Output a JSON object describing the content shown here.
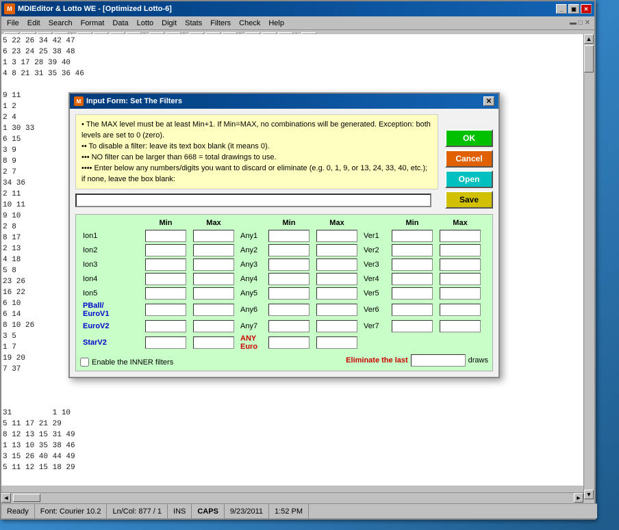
{
  "app": {
    "title": "MDIEditor & Lotto WE - [Optimized Lotto-6]",
    "icon_char": "M"
  },
  "title_buttons": {
    "minimize": "_",
    "restore": "▣",
    "close": "✕"
  },
  "menu": {
    "items": [
      "File",
      "Edit",
      "Search",
      "Format",
      "Data",
      "Lotto",
      "Digit",
      "Stats",
      "Filters",
      "Check",
      "Help"
    ]
  },
  "toolbar": {
    "buttons": [
      "📄",
      "📂",
      "💾",
      "🖨",
      "✂",
      "📋",
      "📋",
      "✕",
      "🔍",
      "A",
      "B",
      "I",
      "U",
      "≡",
      "≡",
      "≡",
      "❓"
    ]
  },
  "dialog": {
    "title": "Input Form: Set The Filters",
    "icon_char": "M",
    "close_btn": "✕",
    "info_lines": [
      "• The MAX level must be at least Min+1. If Min=MAX, no combinations will be generated.  Exception: both levels are set to 0 (zero).",
      "•• To disable a filter: leave its text box blank (it means 0).",
      "••• NO filter can be larger than 668 = total drawings to use.",
      "•••• Enter below any numbers/digits you want to discard or eliminate  (e.g.  0, 1, 9, or 13, 24, 33, 40, etc.);  if none, leave the box blank:"
    ],
    "buttons": {
      "ok": "OK",
      "cancel": "Cancel",
      "open": "Open",
      "save": "Save"
    }
  },
  "grid": {
    "col_headers": [
      "",
      "Min",
      "Max",
      "",
      "Min",
      "Max",
      "",
      "Min",
      "Max"
    ],
    "rows": [
      {
        "label": "Ion1",
        "label_style": "normal",
        "col": "ion"
      },
      {
        "label": "Ion2",
        "label_style": "normal",
        "col": "ion"
      },
      {
        "label": "Ion3",
        "label_style": "normal",
        "col": "ion"
      },
      {
        "label": "Ion4",
        "label_style": "normal",
        "col": "ion"
      },
      {
        "label": "Ion5",
        "label_style": "normal",
        "col": "ion"
      },
      {
        "label": "PBall/\nEuroV1",
        "label_style": "blue",
        "col": "pball"
      },
      {
        "label": "EuroV2",
        "label_style": "blue",
        "col": "euro"
      },
      {
        "label": "StarV2",
        "label_style": "blue",
        "col": "star"
      }
    ],
    "any_rows": [
      {
        "label": "Any1"
      },
      {
        "label": "Any2"
      },
      {
        "label": "Any3"
      },
      {
        "label": "Any4"
      },
      {
        "label": "Any5"
      },
      {
        "label": "Any6"
      },
      {
        "label": "Any7"
      }
    ],
    "ver_rows": [
      {
        "label": "Ver1"
      },
      {
        "label": "Ver2"
      },
      {
        "label": "Ver3"
      },
      {
        "label": "Ver4"
      },
      {
        "label": "Ver5"
      },
      {
        "label": "Ver6"
      },
      {
        "label": "Ver7"
      }
    ],
    "any_euro_label": "ANY\nEuro",
    "any_euro_style": "red"
  },
  "checkbox": {
    "label": "Enable the INNER filters"
  },
  "eliminate": {
    "label": "Eliminate the last",
    "suffix": "draws"
  },
  "status_bar": {
    "ready": "Ready",
    "font": "Font: Courier 10.2",
    "position": "Ln/Col: 877 / 1",
    "ins": "INS",
    "caps": "CAPS",
    "date": "9/23/2011",
    "time": "1:52 PM"
  },
  "background_numbers": [
    "5  22  26  34  42  47",
    "6  23  24  25  38  48",
    "1   3  17  28  39  40",
    "4   8  21  31  35  36  46",
    "",
    "9  11",
    "1   2",
    "2   4",
    "1  30  33",
    "6  15",
    "3   9",
    "8   9",
    "2   7",
    "34  36",
    "2  11",
    "10  11",
    "9  10",
    "2   8",
    "8  17",
    "2  13",
    "4  18",
    "5   8",
    "23  26",
    "16  22",
    "6  10",
    "6  14",
    "8  10  26",
    "3   5",
    "1   7",
    "19  20",
    "7  37"
  ]
}
